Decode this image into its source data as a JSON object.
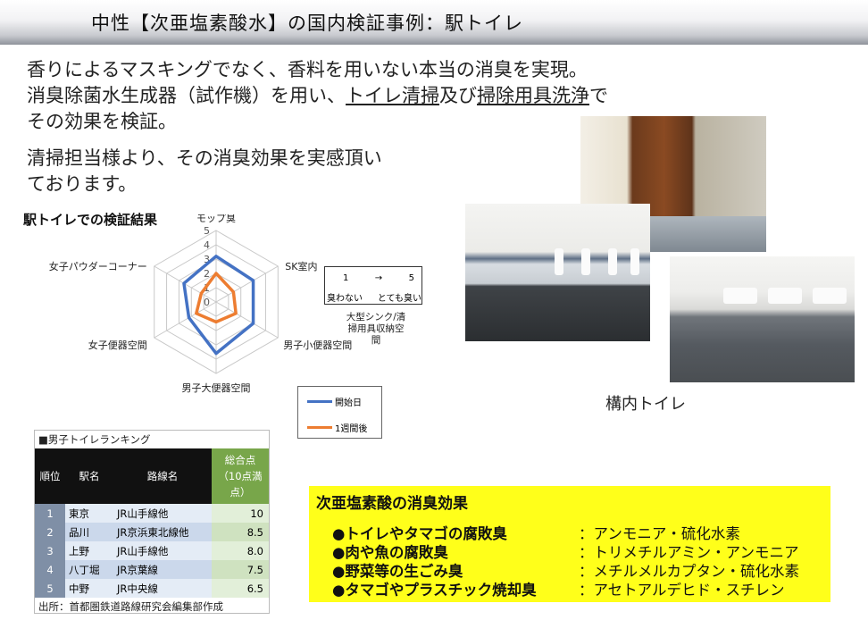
{
  "header": {
    "title": "中性【次亜塩素酸水】の国内検証事例：駅トイレ"
  },
  "intro": {
    "line1": "香りによるマスキングでなく、香料を用いない本当の消臭を実現。",
    "line2_pre": "消臭除菌水生成器（試作機）を用い、",
    "line2_u1": "トイレ清掃",
    "line2_mid": "及び",
    "line2_u2": "掃除用具洗浄",
    "line2_post": "で",
    "line3": "その効果を検証。",
    "para2_line1": "清掃担当様より、その消臭効果を実感頂い",
    "para2_line2": "ております。"
  },
  "chart_data": {
    "type": "radar",
    "title": "駅トイレでの検証結果",
    "axes": [
      "モップ臭",
      "SK室内",
      "男子小便器空間",
      "男子大便器空間",
      "女子便器空間",
      "女子パウダーコーナー"
    ],
    "axis_display": [
      "モップ臭",
      "SK室内",
      "男子小便器空間",
      "男子大便器空間",
      "女子便器空間",
      "女子パウダーコーナー"
    ],
    "scale_ticks": [
      "0",
      "1",
      "2",
      "3",
      "4",
      "5"
    ],
    "rmax": 5,
    "series": [
      {
        "name": "開始日",
        "color": "#4472c4",
        "values": [
          3.2,
          3.0,
          3.0,
          3.6,
          2.2,
          2.6
        ]
      },
      {
        "name": "1週間後",
        "color": "#ed7d31",
        "values": [
          2.0,
          1.4,
          1.6,
          1.4,
          1.6,
          1.2
        ]
      }
    ],
    "scale_legend": {
      "from": "1",
      "arrow": "→",
      "to": "5",
      "low": "臭わない",
      "high": "とても臭い"
    },
    "side_note": "大型シンク/清掃用具収納空間"
  },
  "photos": {
    "caption": "構内トイレ"
  },
  "ranking": {
    "title": "■男子トイレランキング",
    "headers": {
      "rank": "順位",
      "station": "駅名",
      "line": "路線名",
      "score_l1": "総合点",
      "score_l2": "（10点満",
      "score_l3": "点）"
    },
    "rows": [
      {
        "rank": "1",
        "station": "東京",
        "line": "JR山手線他",
        "score": "10"
      },
      {
        "rank": "2",
        "station": "品川",
        "line": "JR京浜東北線他",
        "score": "8.5"
      },
      {
        "rank": "3",
        "station": "上野",
        "line": "JR山手線他",
        "score": "8.0"
      },
      {
        "rank": "4",
        "station": "八丁堀",
        "line": "JR京葉線",
        "score": "7.5"
      },
      {
        "rank": "5",
        "station": "中野",
        "line": "JR中央線",
        "score": "6.5"
      }
    ],
    "source": "出所：首都圏鉄道路線研究会編集部作成"
  },
  "effects": {
    "title": "次亜塩素酸の消臭効果",
    "items": [
      {
        "label": "●トイレやタマゴの腐敗臭",
        "substance": "：アンモニア・硫化水素"
      },
      {
        "label": "●肉や魚の腐敗臭",
        "substance": "：トリメチルアミン・アンモニア"
      },
      {
        "label": "●野菜等の生ごみ臭",
        "substance": "：メチルメルカプタン・硫化水素"
      },
      {
        "label": "●タマゴやプラスチック焼却臭",
        "substance": "：アセトアルデヒド・スチレン"
      }
    ]
  }
}
